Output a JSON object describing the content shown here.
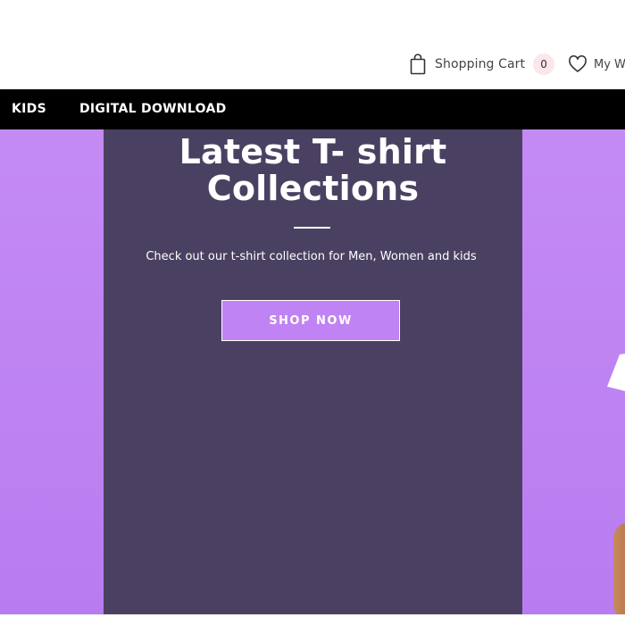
{
  "header": {
    "cart": {
      "label": "Shopping Cart",
      "count": "0",
      "icon": "shopping-bag-icon"
    },
    "wishlist": {
      "label": "My Wi",
      "icon": "heart-icon"
    }
  },
  "nav": {
    "items": [
      {
        "label": "KIDS"
      },
      {
        "label": "DIGITAL DOWNLOAD"
      }
    ]
  },
  "hero": {
    "title_line1": "Latest T- shirt",
    "title_line2": "Collections",
    "subtitle": "Check out our t-shirt collection for Men, Women and kids",
    "button_label": "SHOP NOW"
  },
  "colors": {
    "nav_bg": "#000000",
    "hero_bg": "#c083f3",
    "panel_bg": "#4a4162",
    "cart_badge_bg": "#fbe6e9"
  }
}
